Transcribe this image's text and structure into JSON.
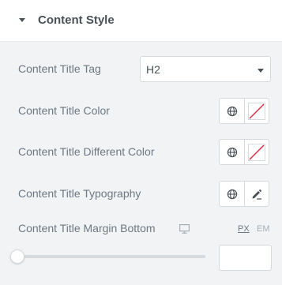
{
  "section": {
    "title": "Content Style",
    "caret_icon": "caret-down-icon"
  },
  "controls": {
    "title_tag": {
      "label": "Content Title Tag",
      "value": "H2",
      "arrow_icon": "chevron-down-icon"
    },
    "title_color": {
      "label": "Content Title Color",
      "global_icon": "globe-icon",
      "swatch_icon": "no-color-swatch-icon"
    },
    "title_different_color": {
      "label": "Content Title Different Color",
      "global_icon": "globe-icon",
      "swatch_icon": "no-color-swatch-icon"
    },
    "title_typography": {
      "label": "Content Title Typography",
      "global_icon": "globe-icon",
      "edit_icon": "pencil-icon"
    },
    "title_margin_bottom": {
      "label": "Content Title Margin Bottom",
      "device_icon": "desktop-monitor-icon",
      "units": [
        "PX",
        "EM"
      ],
      "active_unit": "PX",
      "slider_value": 0,
      "input_value": ""
    }
  },
  "colors": {
    "accent_red": "#d72b3f",
    "label": "#6d7882",
    "heading": "#495157",
    "border": "#d5dadf"
  }
}
